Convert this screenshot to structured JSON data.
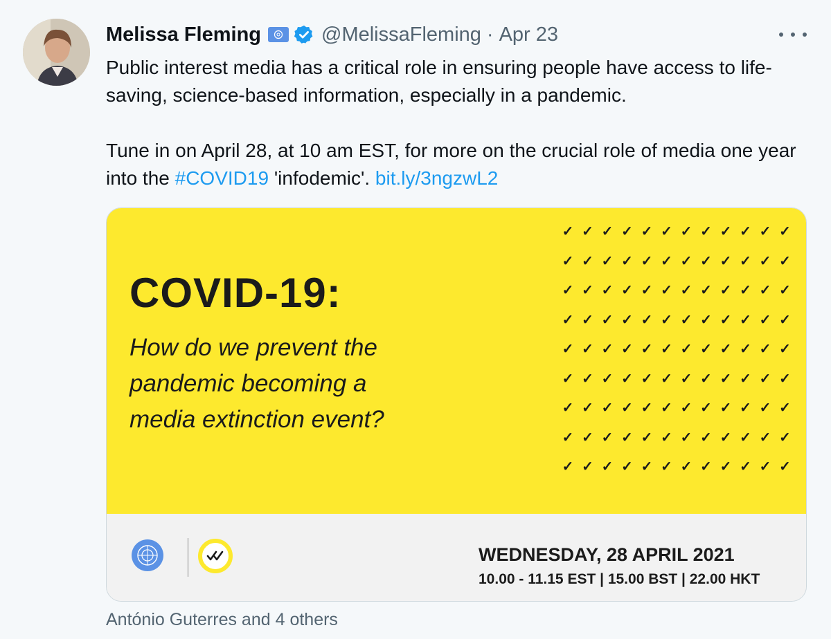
{
  "tweet": {
    "author_name": "Melissa Fleming",
    "handle": "@MelissaFleming",
    "separator": "·",
    "date": "Apr 23",
    "paragraph1": "Public interest media has a critical role in ensuring people have access to life-saving, science-based information, especially in a pandemic.",
    "paragraph2_prefix": "Tune in on April 28, at 10 am EST, for more on the crucial role of media one year into the ",
    "hashtag": "#COVID19",
    "paragraph2_middle": " 'infodemic'. ",
    "link": "bit.ly/3ngzwL2",
    "liked_by": "António Guterres and 4 others"
  },
  "card": {
    "title": "COVID-19:",
    "subtitle_lines": [
      "How do we prevent the",
      "pandemic becoming a",
      "media extinction event?"
    ],
    "event_date": "WEDNESDAY, 28 APRIL 2021",
    "event_time": "10.00 - 11.15 EST | 15.00 BST | 22.00 HKT"
  },
  "icons": {
    "flag": "un-flag-icon",
    "verified": "verified-badge-icon",
    "more": "more-options-icon",
    "un_logo": "un-emblem-icon",
    "check_logo": "double-check-logo-icon"
  },
  "colors": {
    "accent": "#1d9bf0",
    "card_yellow": "#fde92e",
    "muted_text": "#536471"
  }
}
